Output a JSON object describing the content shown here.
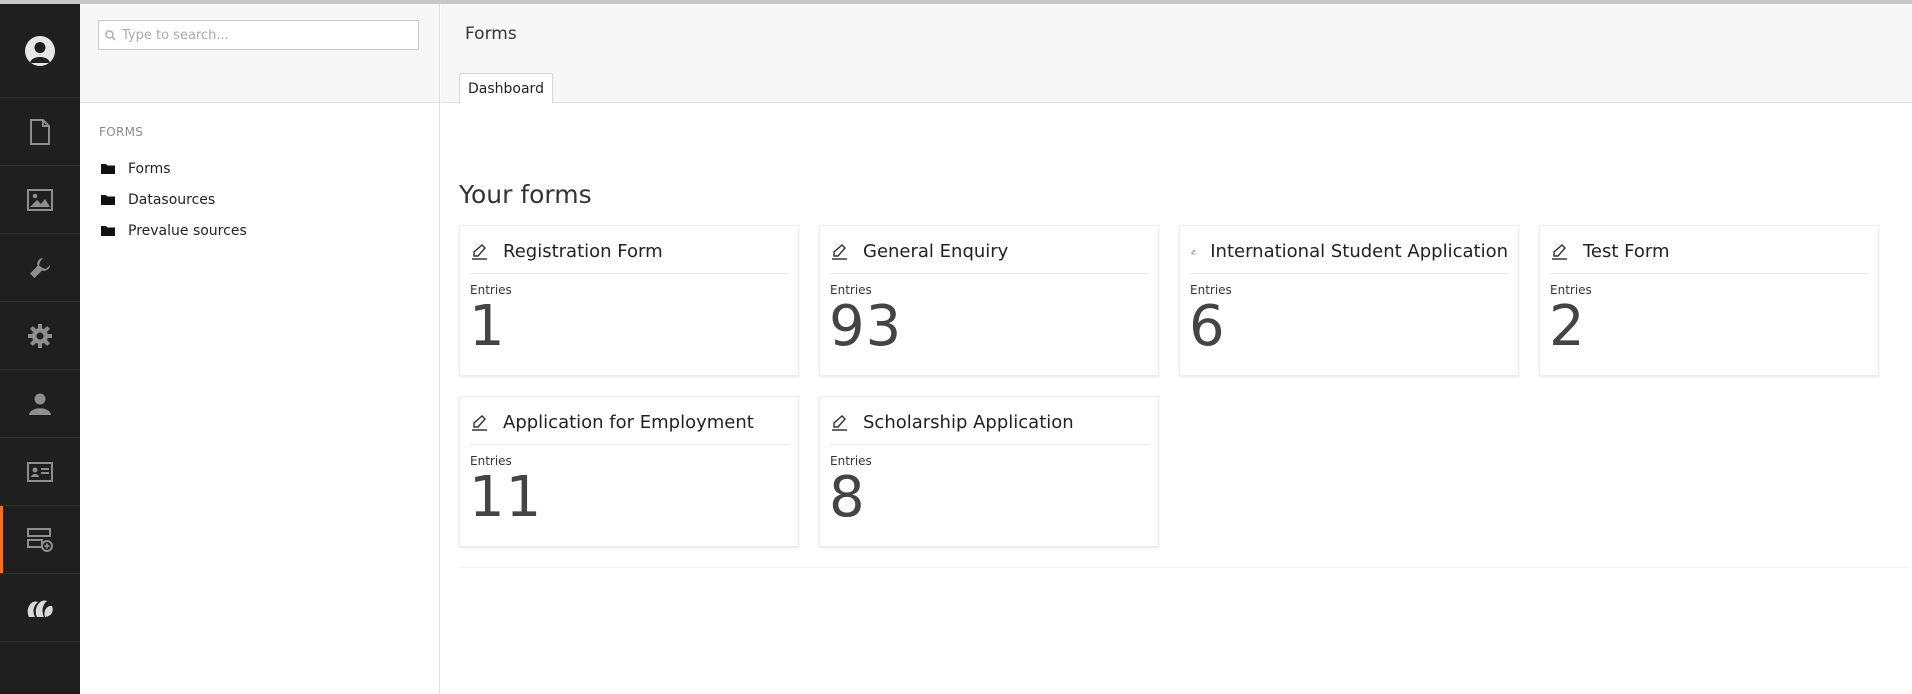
{
  "search": {
    "placeholder": "Type to search..."
  },
  "tree": {
    "section_title": "FORMS",
    "items": [
      {
        "label": "Forms"
      },
      {
        "label": "Datasources"
      },
      {
        "label": "Prevalue sources"
      }
    ]
  },
  "header": {
    "title": "Forms",
    "tab": "Dashboard"
  },
  "main": {
    "heading": "Your forms",
    "entries_label": "Entries",
    "cards": [
      {
        "name": "Registration Form",
        "entries_label": "Entries",
        "count": "1"
      },
      {
        "name": "General Enquiry",
        "entries_label": "Entries",
        "count": "93"
      },
      {
        "name": "International Student Application",
        "entries_label": "Entries",
        "count": "6"
      },
      {
        "name": "Test Form",
        "entries_label": "Entries",
        "count": "2"
      },
      {
        "name": "Application for Employment",
        "entries_label": "Entries",
        "count": "11"
      },
      {
        "name": "Scholarship Application",
        "entries_label": "Entries",
        "count": "8"
      }
    ]
  },
  "rail": {
    "icons": [
      "user-avatar-icon",
      "document-icon",
      "image-icon",
      "wrench-icon",
      "gear-icon",
      "member-icon",
      "contact-card-icon",
      "forms-icon",
      "umbraco-logo-icon"
    ],
    "accent_color": "#f36f21"
  }
}
